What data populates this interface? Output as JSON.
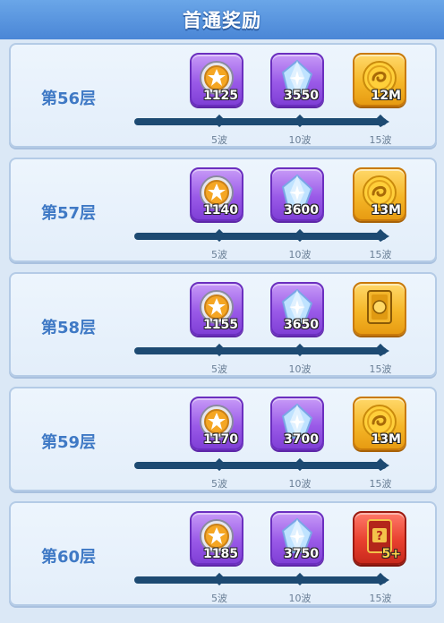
{
  "header": {
    "title": "首通奖励"
  },
  "rows": [
    {
      "floor": "第56层",
      "rewards": [
        {
          "kind": "silver-coin",
          "count": "1125",
          "icon": "silver-star-coin-icon"
        },
        {
          "kind": "crystal",
          "count": "3550",
          "icon": "crystal-shard-icon"
        },
        {
          "kind": "gold-coin",
          "count": "12M",
          "icon": "gold-coin-icon"
        }
      ],
      "waves": [
        "5波",
        "10波",
        "15波"
      ]
    },
    {
      "floor": "第57层",
      "rewards": [
        {
          "kind": "silver-coin",
          "count": "1140",
          "icon": "silver-star-coin-icon"
        },
        {
          "kind": "crystal",
          "count": "3600",
          "icon": "crystal-shard-icon"
        },
        {
          "kind": "gold-coin",
          "count": "13M",
          "icon": "gold-coin-icon"
        }
      ],
      "waves": [
        "5波",
        "10波",
        "15波"
      ]
    },
    {
      "floor": "第58层",
      "rewards": [
        {
          "kind": "silver-coin",
          "count": "1155",
          "icon": "silver-star-coin-icon"
        },
        {
          "kind": "crystal",
          "count": "3650",
          "icon": "crystal-shard-icon"
        },
        {
          "kind": "gold-card",
          "count": "",
          "icon": "gold-card-icon"
        }
      ],
      "waves": [
        "5波",
        "10波",
        "15波"
      ]
    },
    {
      "floor": "第59层",
      "rewards": [
        {
          "kind": "silver-coin",
          "count": "1170",
          "icon": "silver-star-coin-icon"
        },
        {
          "kind": "crystal",
          "count": "3700",
          "icon": "crystal-shard-icon"
        },
        {
          "kind": "gold-coin",
          "count": "13M",
          "icon": "gold-coin-icon"
        }
      ],
      "waves": [
        "5波",
        "10波",
        "15波"
      ]
    },
    {
      "floor": "第60层",
      "rewards": [
        {
          "kind": "silver-coin",
          "count": "1185",
          "icon": "silver-star-coin-icon"
        },
        {
          "kind": "crystal",
          "count": "3750",
          "icon": "crystal-shard-icon"
        },
        {
          "kind": "mystery-card",
          "count": "",
          "badge": "5+",
          "icon": "mystery-card-icon"
        }
      ],
      "waves": [
        "5波",
        "10波",
        "15波"
      ]
    }
  ]
}
